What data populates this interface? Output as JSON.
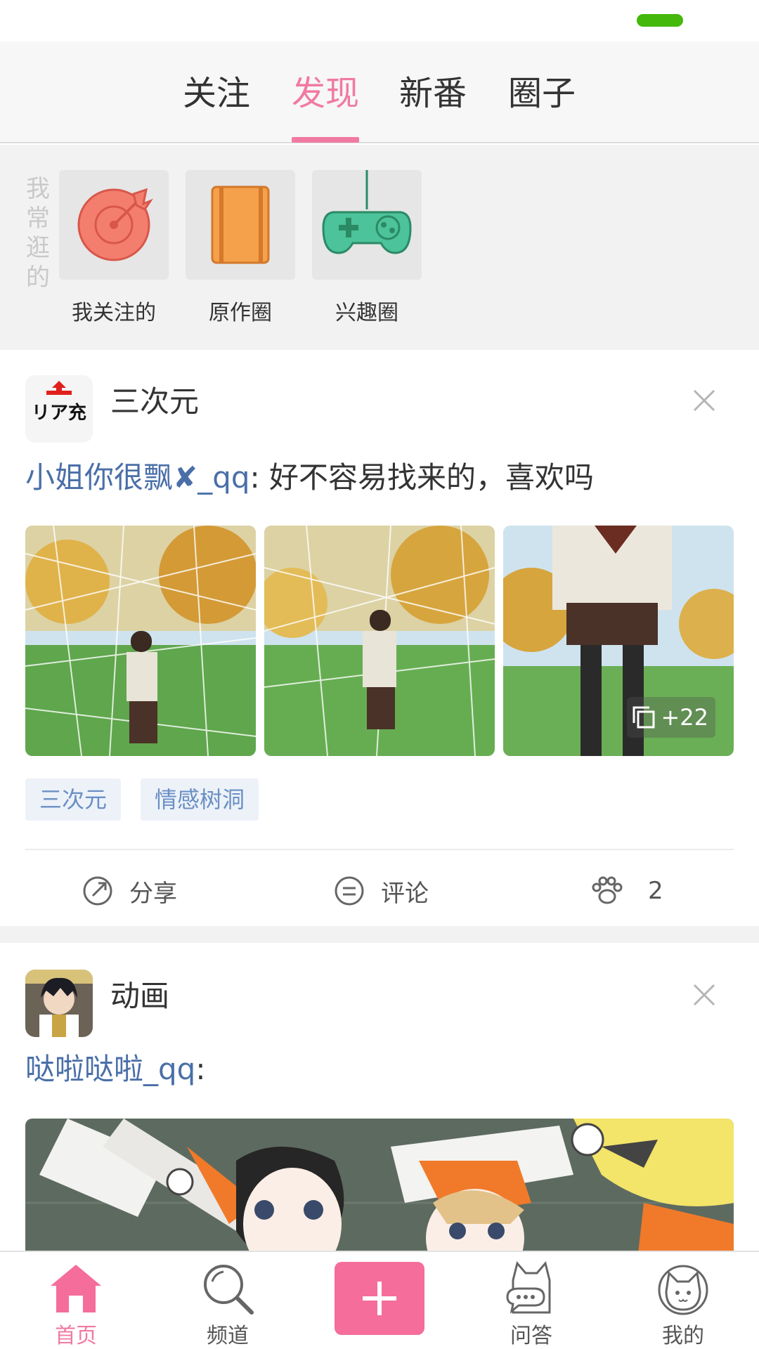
{
  "top_tabs": [
    {
      "label": "关注"
    },
    {
      "label": "发现"
    },
    {
      "label": "新番"
    },
    {
      "label": "圈子"
    }
  ],
  "active_tab": "发现",
  "frequent": {
    "label": "我常逛的",
    "items": [
      {
        "label": "我关注的",
        "icon": "target-icon"
      },
      {
        "label": "原作圈",
        "icon": "notebook-icon"
      },
      {
        "label": "兴趣圈",
        "icon": "gamepad-icon"
      }
    ]
  },
  "posts": [
    {
      "channel": "三次元",
      "avatar_text": "リア充",
      "user": "小姐你很飘✘_qq",
      "separator": ":",
      "text": " 好不容易找来的，喜欢吗",
      "extra_photos": "+22",
      "tags": [
        "三次元",
        "情感树洞"
      ],
      "actions": {
        "share": "分享",
        "comment": "评论",
        "like_count": "2"
      }
    },
    {
      "channel": "动画",
      "user": "哒啦哒啦_qq",
      "separator": ":",
      "text": ""
    }
  ],
  "bottom_nav": [
    {
      "label": "首页",
      "icon": "home-icon"
    },
    {
      "label": "频道",
      "icon": "search-icon"
    },
    {
      "label": "",
      "icon": "plus-icon"
    },
    {
      "label": "问答",
      "icon": "cat-chat-icon"
    },
    {
      "label": "我的",
      "icon": "cat-face-icon"
    }
  ],
  "colors": {
    "accent": "#f07aa2",
    "link": "#4a6fa8",
    "tag_bg": "#edf2f9",
    "status_green": "#44b80b"
  }
}
